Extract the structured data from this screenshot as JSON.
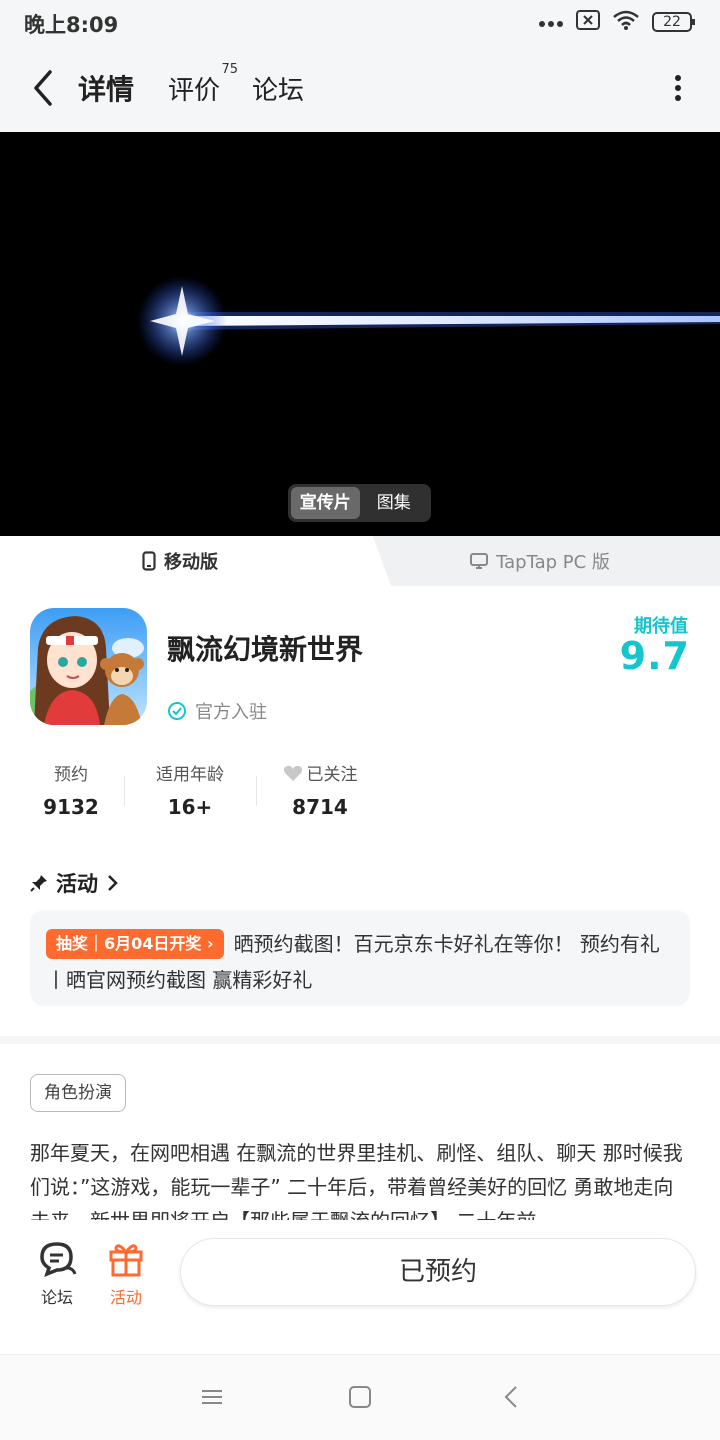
{
  "status_bar": {
    "time": "晚上8:09",
    "battery": "22"
  },
  "header": {
    "tabs": [
      {
        "label": "详情",
        "active": true
      },
      {
        "label": "评价",
        "badge": "75"
      },
      {
        "label": "论坛"
      }
    ]
  },
  "media": {
    "tabs": [
      {
        "label": "宣传片",
        "active": true
      },
      {
        "label": "图集"
      }
    ]
  },
  "platforms": {
    "mobile": "移动版",
    "pc": "TapTap PC 版"
  },
  "app": {
    "name": "飘流幻境新世界",
    "official": "官方入驻",
    "expect_label": "期待值",
    "expect_value": "9.7"
  },
  "stats": [
    {
      "label": "预约",
      "value": "9132"
    },
    {
      "label": "适用年龄",
      "value": "16+"
    },
    {
      "label": "已关注",
      "value": "8714"
    }
  ],
  "activity": {
    "heading": "活动",
    "tag": "抽奖｜6月04日开奖",
    "text": "晒预约截图！百元京东卡好礼在等你！ 预约有礼丨晒官网预约截图 赢精彩好礼"
  },
  "genre": "角色扮演",
  "description": "那年夏天，在网吧相遇 在飘流的世界里挂机、刷怪、组队、聊天 那时候我们说：”这游戏，能玩一辈子” 二十年后，带着曾经美好的回忆 勇敢地走向未来，新世界即将开启【那些属于飘流的回忆】 二十年前",
  "bottom": {
    "forum": "论坛",
    "activity": "活动",
    "reserve_button": "已预约"
  },
  "colors": {
    "accent": "#15c5ce",
    "orange": "#ff6a2f"
  }
}
